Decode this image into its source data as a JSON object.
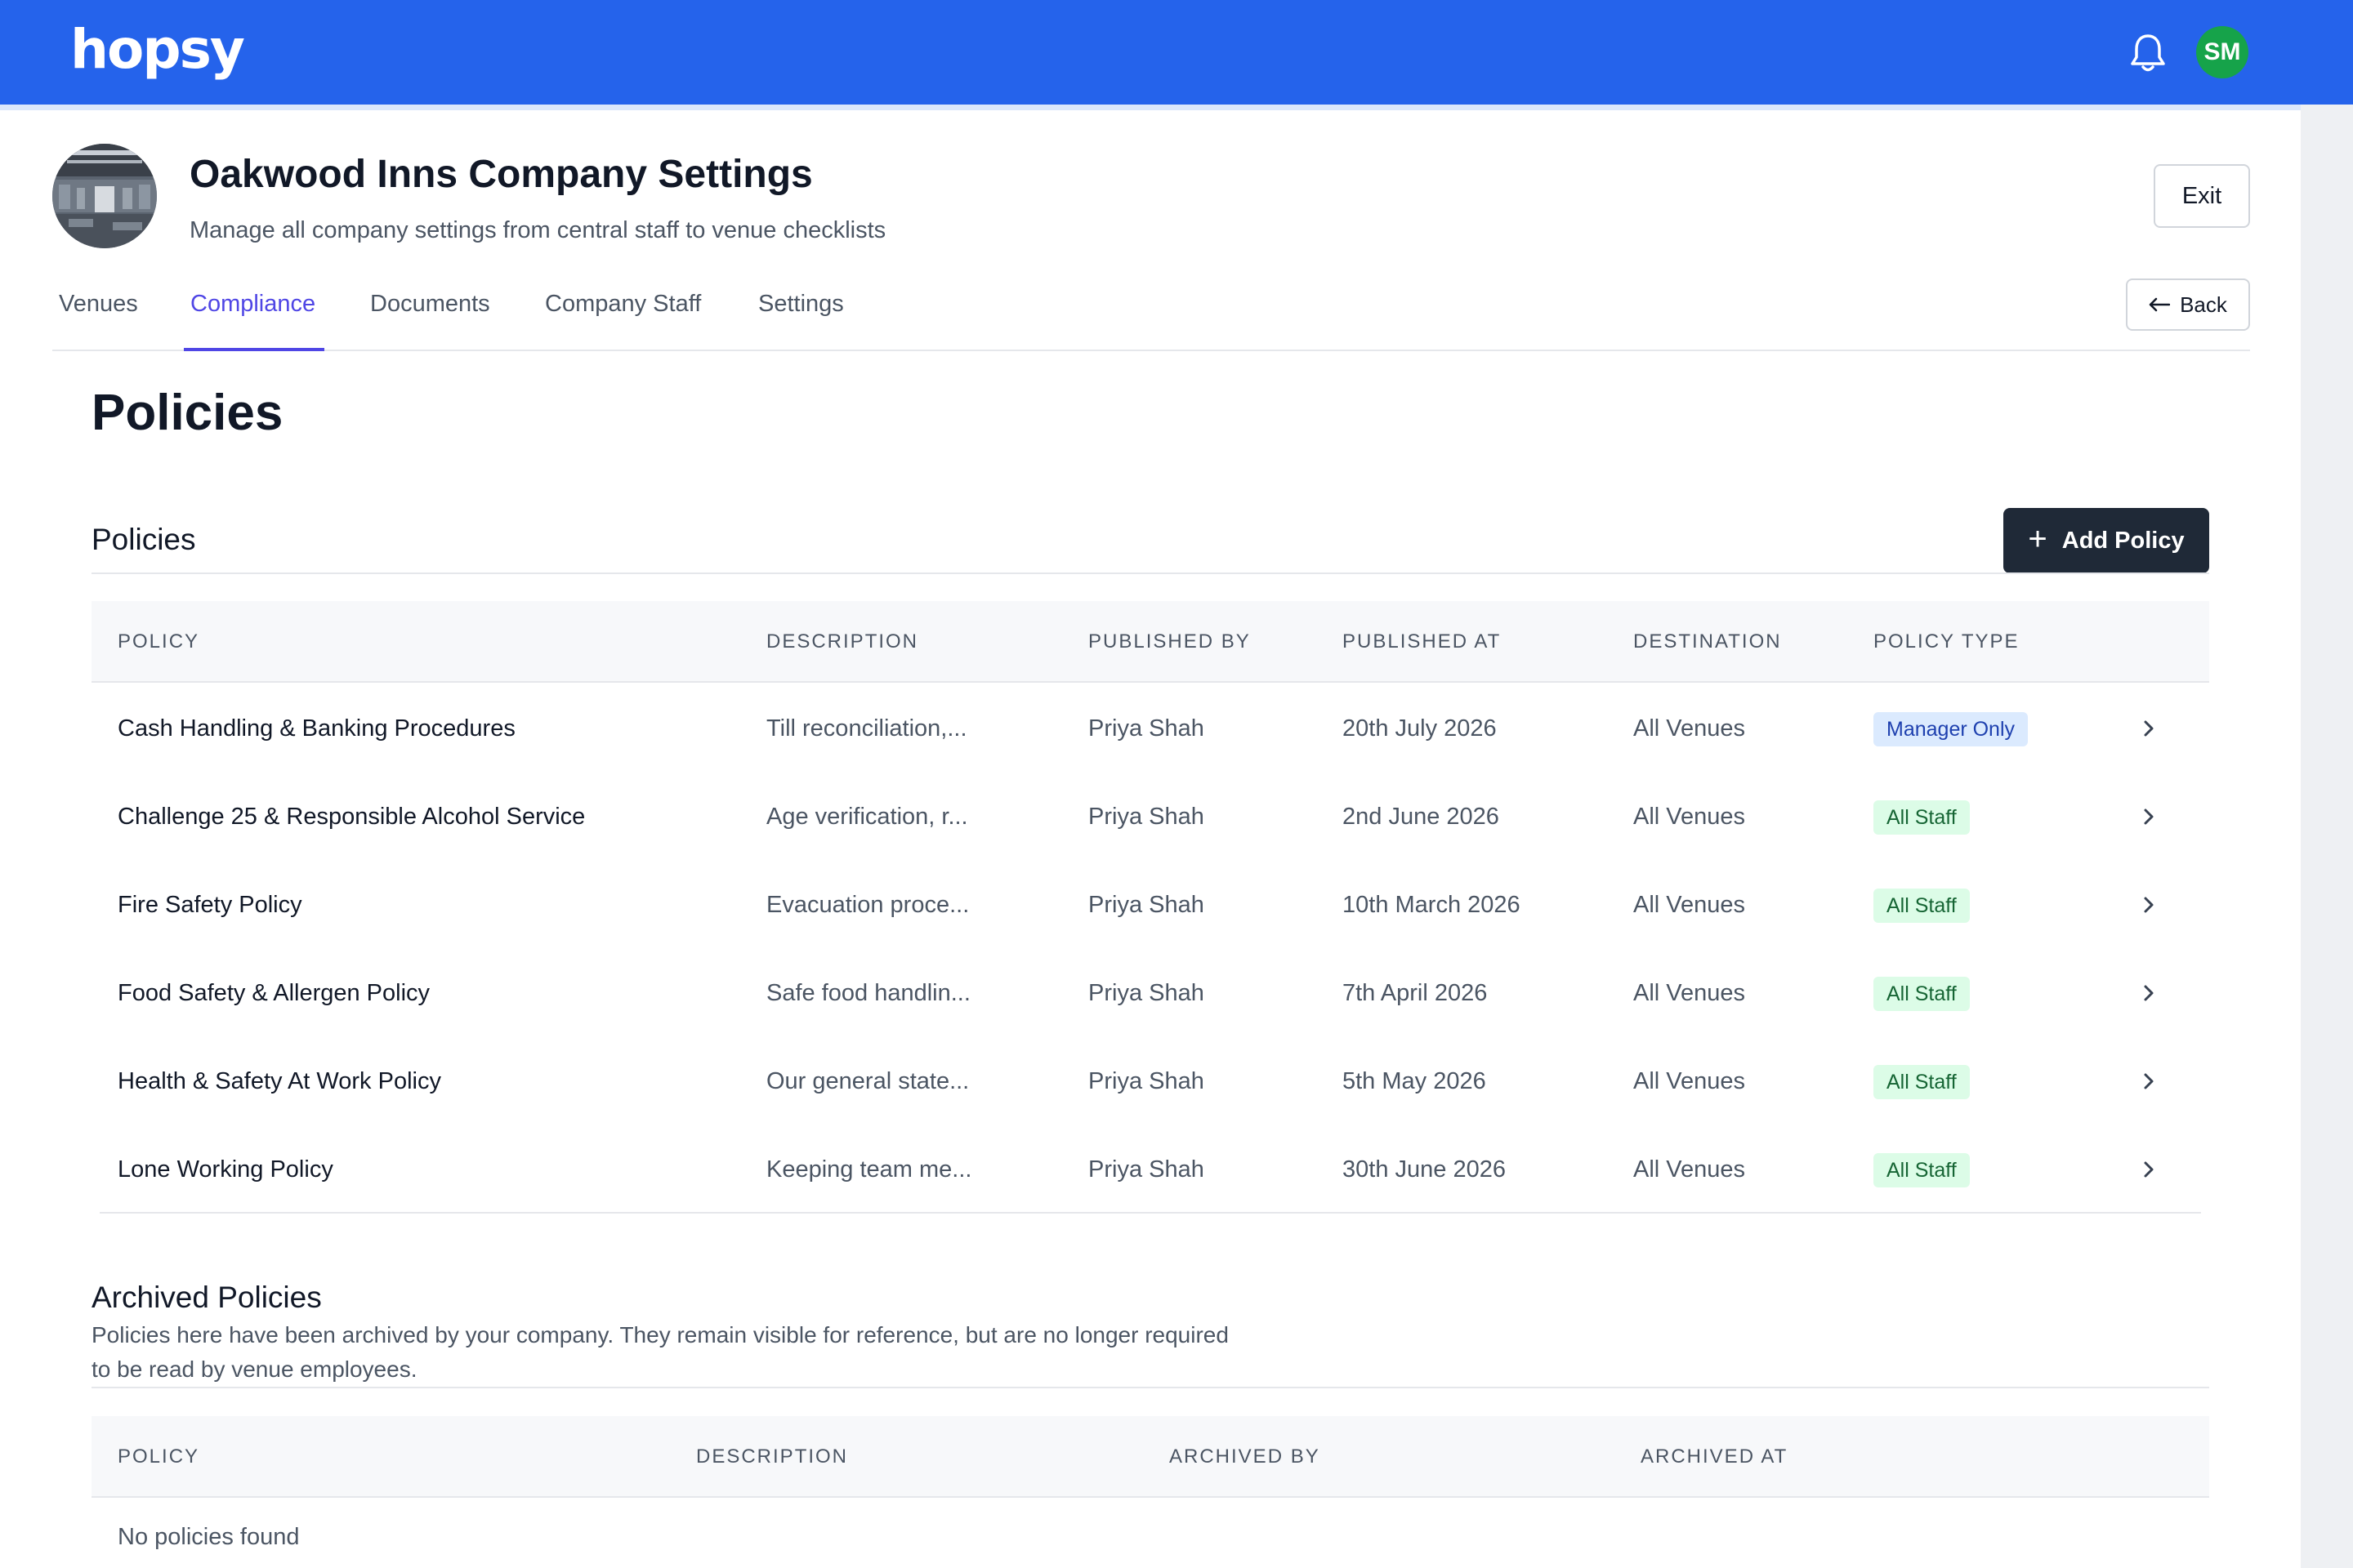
{
  "app": {
    "logo": "hopsy",
    "user_initials": "SM",
    "user_avatar_color": "#16a34a",
    "brand_color": "#2563eb"
  },
  "header": {
    "title": "Oakwood Inns Company Settings",
    "subtitle": "Manage all company settings from central staff to venue checklists",
    "exit_label": "Exit",
    "back_label": "Back"
  },
  "tabs": [
    {
      "label": "Venues",
      "active": false
    },
    {
      "label": "Compliance",
      "active": true
    },
    {
      "label": "Documents",
      "active": false
    },
    {
      "label": "Company Staff",
      "active": false
    },
    {
      "label": "Settings",
      "active": false
    }
  ],
  "page_title": "Policies",
  "policies": {
    "section_title": "Policies",
    "add_label": "Add Policy",
    "columns": [
      "POLICY",
      "DESCRIPTION",
      "PUBLISHED BY",
      "PUBLISHED AT",
      "DESTINATION",
      "POLICY TYPE"
    ],
    "rows": [
      {
        "policy": "Cash Handling & Banking Procedures",
        "description": "Till reconciliation,...",
        "published_by": "Priya Shah",
        "published_at": "20th July 2026",
        "destination": "All Venues",
        "type": "Manager Only"
      },
      {
        "policy": "Challenge 25 & Responsible Alcohol Service",
        "description": "Age verification, r...",
        "published_by": "Priya Shah",
        "published_at": "2nd June 2026",
        "destination": "All Venues",
        "type": "All Staff"
      },
      {
        "policy": "Fire Safety Policy",
        "description": "Evacuation proce...",
        "published_by": "Priya Shah",
        "published_at": "10th March 2026",
        "destination": "All Venues",
        "type": "All Staff"
      },
      {
        "policy": "Food Safety & Allergen Policy",
        "description": "Safe food handlin...",
        "published_by": "Priya Shah",
        "published_at": "7th April 2026",
        "destination": "All Venues",
        "type": "All Staff"
      },
      {
        "policy": "Health & Safety At Work Policy",
        "description": "Our general state...",
        "published_by": "Priya Shah",
        "published_at": "5th May 2026",
        "destination": "All Venues",
        "type": "All Staff"
      },
      {
        "policy": "Lone Working Policy",
        "description": "Keeping team me...",
        "published_by": "Priya Shah",
        "published_at": "30th June 2026",
        "destination": "All Venues",
        "type": "All Staff"
      }
    ]
  },
  "archived": {
    "title": "Archived Policies",
    "description": "Policies here have been archived by your company. They remain visible for reference, but are no longer required to be read by venue employees.",
    "columns": [
      "POLICY",
      "DESCRIPTION",
      "ARCHIVED BY",
      "ARCHIVED AT"
    ],
    "empty_text": "No policies found"
  }
}
